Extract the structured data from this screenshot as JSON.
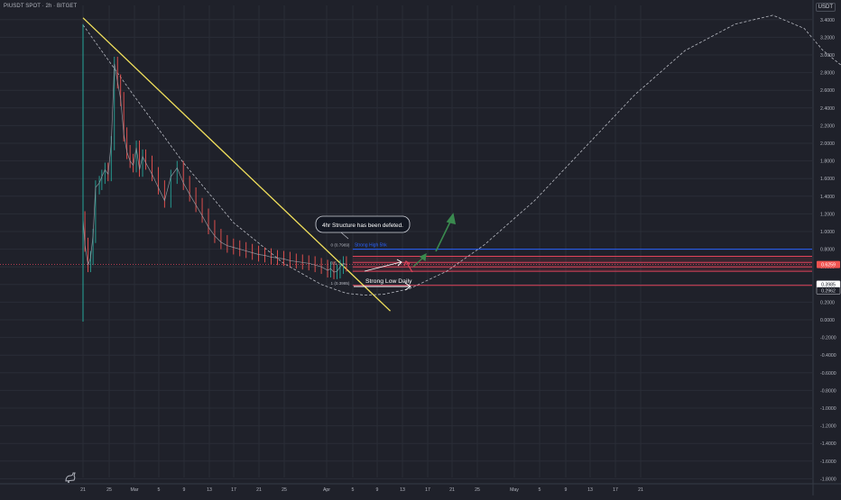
{
  "header": {
    "symbol_title": "PIUSDT SPOT · 2h · BITGET",
    "currency": "USDT"
  },
  "colors": {
    "background": "#1f212a",
    "grid": "#2a2d37",
    "up_candle": "#26a69a",
    "down_candle": "#ef5350",
    "trendline": "#f2e15c",
    "projection": "#d1d4dc",
    "blue_level": "#2962ff",
    "red_level": "#e0445b",
    "green_arrow": "#3a8a4f",
    "price_badge": "#ef5350"
  },
  "chart_data": {
    "type": "line",
    "y_axis": {
      "ticks": [
        "3.4000",
        "3.2000",
        "3.0000",
        "2.8000",
        "2.6000",
        "2.4000",
        "2.2000",
        "2.0000",
        "1.8000",
        "1.6000",
        "1.4000",
        "1.2000",
        "1.0000",
        "0.8000",
        "0.6000",
        "0.4000",
        "0.2000",
        "0.0000",
        "-0.2000",
        "-0.4000",
        "-0.6000",
        "-0.8000",
        "-1.0000",
        "-1.2000",
        "-1.4000",
        "-1.6000",
        "-1.8000"
      ],
      "ylim": [
        -1.86,
        3.52
      ]
    },
    "x_axis": {
      "ticks": [
        "21",
        "25",
        "Mar",
        "5",
        "9",
        "13",
        "17",
        "21",
        "25",
        "Apr",
        "5",
        "9",
        "13",
        "17",
        "21",
        "25",
        "May",
        "5",
        "9",
        "13",
        "17",
        "21"
      ]
    },
    "current_price": "0.6259",
    "price_labels": [
      "0.3985",
      "0.2962"
    ],
    "price_series": {
      "days": [
        0,
        0.3,
        0.8,
        1.2,
        1.6,
        2,
        2.6,
        3,
        3.5,
        4,
        4.5,
        5,
        5.5,
        6,
        6.5,
        7,
        7.5,
        8,
        8.5,
        9,
        9.5,
        10,
        11,
        12,
        13,
        14,
        15,
        16,
        17,
        18,
        19,
        20,
        21,
        22,
        23,
        24,
        25,
        26,
        27,
        28,
        29,
        30,
        31,
        32,
        33,
        34,
        35,
        36,
        37,
        38,
        39,
        39.5,
        40,
        40.5,
        41,
        41.5,
        42
      ],
      "values": [
        1.15,
        0.85,
        0.62,
        0.7,
        0.95,
        1.5,
        1.55,
        1.62,
        1.7,
        1.65,
        2.0,
        2.9,
        2.7,
        2.5,
        2.1,
        1.9,
        1.8,
        1.75,
        1.95,
        1.7,
        1.85,
        1.78,
        1.65,
        1.5,
        1.35,
        1.62,
        1.72,
        1.55,
        1.42,
        1.3,
        1.18,
        1.05,
        0.95,
        0.88,
        0.84,
        0.82,
        0.8,
        0.78,
        0.76,
        0.74,
        0.73,
        0.71,
        0.7,
        0.69,
        0.67,
        0.66,
        0.65,
        0.64,
        0.62,
        0.6,
        0.56,
        0.58,
        0.54,
        0.55,
        0.6,
        0.64,
        0.6259
      ]
    },
    "trendline": {
      "start": {
        "day": 0,
        "value": 3.42
      },
      "end": {
        "day": 49,
        "value": 0.1
      }
    },
    "projection_path": {
      "days": [
        0,
        8,
        16,
        24,
        32,
        38,
        42,
        45,
        48,
        52,
        58,
        64,
        72,
        80,
        88,
        96,
        104,
        110,
        115,
        118,
        122,
        126,
        130,
        135,
        140,
        145,
        150
      ],
      "values": [
        3.34,
        2.55,
        1.78,
        1.1,
        0.64,
        0.4,
        0.3,
        0.28,
        0.29,
        0.35,
        0.55,
        0.85,
        1.35,
        1.95,
        2.55,
        3.05,
        3.35,
        3.45,
        3.3,
        3.05,
        2.82,
        2.65,
        2.58,
        2.6,
        2.82,
        3.12,
        3.45
      ]
    },
    "levels": [
      {
        "label": "Strong High 5hk",
        "value": 0.8,
        "color": "#2962ff"
      },
      {
        "label": "",
        "value": 0.72,
        "color": "#e0445b"
      },
      {
        "label": "",
        "value": 0.65,
        "color": "#e0445b"
      },
      {
        "label": "",
        "value": 0.6,
        "color": "#e0445b"
      },
      {
        "label": "",
        "value": 0.55,
        "color": "#e0445b"
      },
      {
        "label": "",
        "value": 0.39,
        "color": "#e0445b"
      }
    ],
    "fib_labels": [
      {
        "text": "0 (0.7969)",
        "value": 0.83
      },
      {
        "text": "0.5",
        "value": 0.63
      },
      {
        "text": "1 (0.3985)",
        "value": 0.4
      }
    ],
    "annotations": {
      "structure_callout": "4hr Structure has been defeted.",
      "strong_low": "Strong Low Daily"
    },
    "price_scale_badge_current": "0.6259"
  }
}
